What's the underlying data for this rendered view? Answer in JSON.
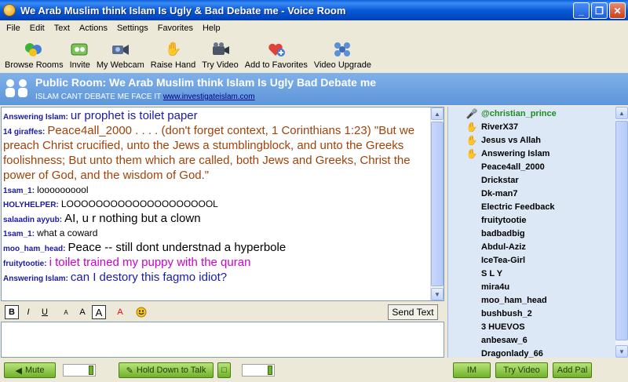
{
  "window": {
    "title": "We Arab Muslim think Islam Is Ugly & Bad Debate me - Voice Room"
  },
  "menu": [
    "File",
    "Edit",
    "Text",
    "Actions",
    "Settings",
    "Favorites",
    "Help"
  ],
  "toolbar": [
    {
      "label": "Browse Rooms",
      "icon": "browse-rooms-icon"
    },
    {
      "label": "Invite",
      "icon": "invite-icon"
    },
    {
      "label": "My Webcam",
      "icon": "webcam-icon"
    },
    {
      "label": "Raise Hand",
      "icon": "raise-hand-icon"
    },
    {
      "label": "Try Video",
      "icon": "video-camera-icon"
    },
    {
      "label": "Add to Favorites",
      "icon": "add-favorite-icon"
    },
    {
      "label": "Video Upgrade",
      "icon": "video-upgrade-icon"
    }
  ],
  "room": {
    "title": "Public Room: We Arab Muslim think Islam Is Ugly  Bad Debate me",
    "subtitle": "ISLAM CANT DEBATE ME FACE IT",
    "link": "www.investigateislam.com"
  },
  "messages": [
    {
      "user": "Answering Islam:",
      "text": "ur prophet is toilet paper",
      "color": "#1a1aa6",
      "large": true
    },
    {
      "user": "14 giraffes:",
      "text": "Peace4all_2000 . . . . (don't forget context, 1 Corinthians 1:23)   \"But we preach Christ crucified, unto the Jews a stumblingblock, and unto the Greeks foolishness; But unto them which are called, both Jews and Greeks, Christ the power of God, and the wisdom of God.\"",
      "color": "#a0430a",
      "large": true
    },
    {
      "user": "1sam_1:",
      "text": "loooooooool",
      "color": "#000000",
      "large": false
    },
    {
      "user": "HOLYHELPER:",
      "text": "LOOOOOOOOOOOOOOOOOOOOL",
      "color": "#000000",
      "large": false
    },
    {
      "user": "salaadin ayyub:",
      "text": "AI, u r nothing but a clown",
      "color": "#000000",
      "large": true
    },
    {
      "user": "1sam_1:",
      "text": "what a coward",
      "color": "#000000",
      "large": false
    },
    {
      "user": "moo_ham_head:",
      "text": "Peace -- still dont understnad a hyperbole",
      "color": "#000000",
      "large": true
    },
    {
      "user": "fruitytootie:",
      "text": "i toilet trained my puppy with the quran",
      "color": "#cc00cc",
      "large": true
    },
    {
      "user": "Answering Islam:",
      "text": "can I destory this fagmo idiot?",
      "color": "#1a1aa6",
      "large": true
    }
  ],
  "format": {
    "send_label": "Send Text"
  },
  "users": [
    {
      "name": "@christian_prince",
      "icon": "microphone-icon",
      "green": true
    },
    {
      "name": "RiverX37",
      "icon": "raised-hand-icon",
      "green": false
    },
    {
      "name": "Jesus vs Allah",
      "icon": "raised-hand-icon",
      "green": false
    },
    {
      "name": "Answering Islam",
      "icon": "raised-hand-icon",
      "green": false
    },
    {
      "name": "Peace4all_2000",
      "icon": "",
      "green": false
    },
    {
      "name": "Drickstar",
      "icon": "",
      "green": false
    },
    {
      "name": "Dk-man7",
      "icon": "",
      "green": false
    },
    {
      "name": "Electric Feedback",
      "icon": "",
      "green": false
    },
    {
      "name": "fruitytootie",
      "icon": "",
      "green": false
    },
    {
      "name": "badbadbig",
      "icon": "",
      "green": false
    },
    {
      "name": "Abdul-Aziz",
      "icon": "",
      "green": false
    },
    {
      "name": "IceTea-Girl",
      "icon": "",
      "green": false
    },
    {
      "name": "S L Y",
      "icon": "",
      "green": false
    },
    {
      "name": "mira4u",
      "icon": "",
      "green": false
    },
    {
      "name": "moo_ham_head",
      "icon": "",
      "green": false
    },
    {
      "name": "bushbush_2",
      "icon": "",
      "green": false
    },
    {
      "name": "3 HUEVOS",
      "icon": "",
      "green": false
    },
    {
      "name": "anbesaw_6",
      "icon": "",
      "green": false
    },
    {
      "name": "Dragonlady_66",
      "icon": "",
      "green": false
    }
  ],
  "bottom": {
    "mute_label": "Mute",
    "talk_label": "Hold Down to Talk",
    "im_label": "IM",
    "try_video_label": "Try Video",
    "add_pal_label": "Add Pal"
  }
}
